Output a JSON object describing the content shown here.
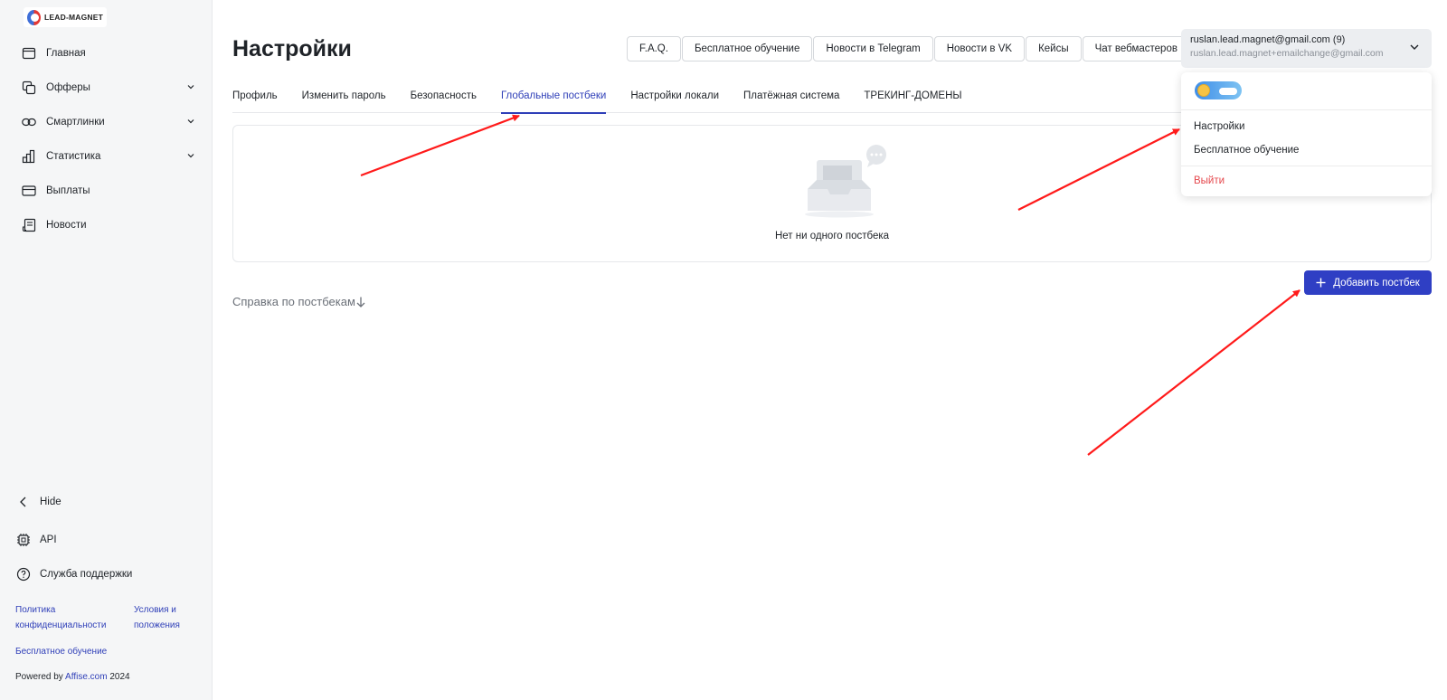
{
  "app": {
    "logo_text": "LEAD-MAGNET"
  },
  "sidebar": {
    "items": [
      {
        "label": "Главная",
        "icon": "window-icon",
        "has_submenu": false
      },
      {
        "label": "Офферы",
        "icon": "layers-icon",
        "has_submenu": true
      },
      {
        "label": "Смартлинки",
        "icon": "link-icon",
        "has_submenu": true
      },
      {
        "label": "Статистика",
        "icon": "bar-chart-icon",
        "has_submenu": true
      },
      {
        "label": "Выплаты",
        "icon": "card-icon",
        "has_submenu": false
      },
      {
        "label": "Новости",
        "icon": "news-icon",
        "has_submenu": false
      }
    ],
    "hide_label": "Hide",
    "api_label": "API",
    "support_label": "Служба поддержки",
    "privacy_link_line1": "Политика",
    "privacy_link_line2": "конфиденциальности",
    "terms_link_line1": "Условия и",
    "terms_link_line2": "положения",
    "training_link": "Бесплатное обучение",
    "powered_prefix": "Powered by",
    "powered_brand": "Affise.com",
    "powered_year": "2024"
  },
  "header": {
    "title": "Настройки",
    "top_links": [
      "F.A.Q.",
      "Бесплатное обучение",
      "Новости в Telegram",
      "Новости в VK",
      "Кейсы",
      "Чат вебмастеров"
    ],
    "account": {
      "email": "ruslan.lead.magnet@gmail.com (9)",
      "secondary_email": "ruslan.lead.magnet+emailchange@gmail.com"
    }
  },
  "tabs": [
    {
      "label": "Профиль",
      "active": false
    },
    {
      "label": "Изменить пароль",
      "active": false
    },
    {
      "label": "Безопасность",
      "active": false
    },
    {
      "label": "Глобальные постбеки",
      "active": true
    },
    {
      "label": "Настройки локали",
      "active": false
    },
    {
      "label": "Платёжная система",
      "active": false
    },
    {
      "label": "ТРЕКИНГ-ДОМЕНЫ",
      "active": false
    }
  ],
  "main": {
    "empty_text": "Нет ни одного постбека",
    "help_link": "Справка по постбекам",
    "add_button": "Добавить постбек"
  },
  "dropdown": {
    "settings": "Настройки",
    "training": "Бесплатное обучение",
    "logout": "Выйти"
  },
  "colors": {
    "accent": "#2f3fc4",
    "danger": "#e5484d",
    "annotation": "#ff1a1a"
  }
}
